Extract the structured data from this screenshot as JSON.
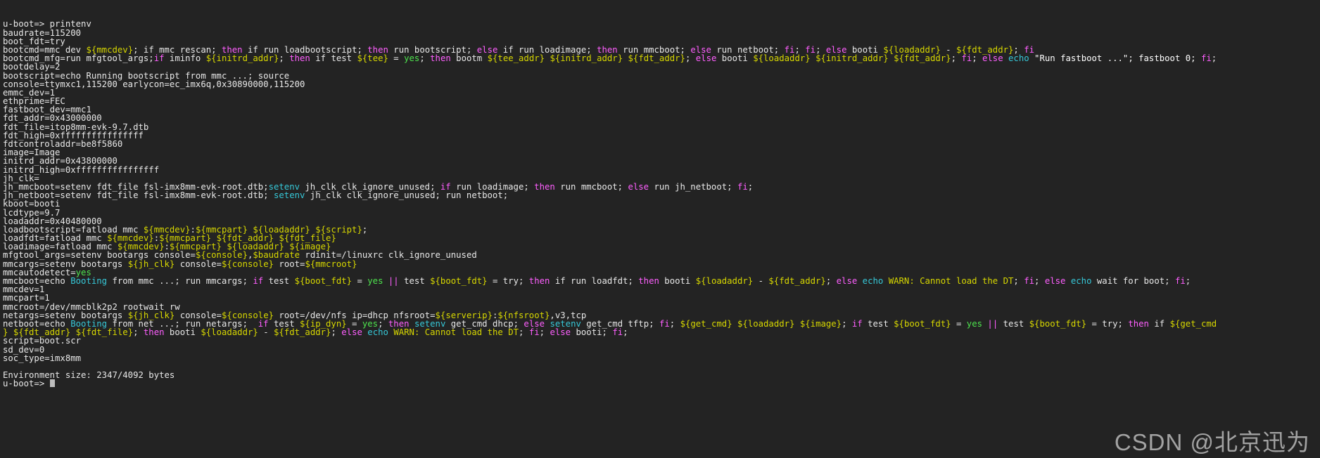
{
  "terminal": {
    "title": "u-boot console",
    "prompt": "u-boot=> ",
    "command": "printenv",
    "env_size_line": "Environment size: 2347/4092 bytes",
    "colors": {
      "background": "#232323",
      "foreground": "#e8e8e8",
      "variable": "#d7d700",
      "keyword": "#ff5fff",
      "command": "#36c8d8",
      "true_value": "#4ee44e",
      "warning": "#d7d700",
      "watermark": "#b9b9b9"
    },
    "lines": [
      [
        {
          "t": "u-boot=> printenv",
          "c": "plain"
        }
      ],
      [
        {
          "t": "baudrate=115200",
          "c": "plain"
        }
      ],
      [
        {
          "t": "boot_fdt=try",
          "c": "plain"
        }
      ],
      [
        {
          "t": "bootcmd=mmc dev ",
          "c": "plain"
        },
        {
          "t": "${mmcdev}",
          "c": "var"
        },
        {
          "t": "; if mmc rescan; ",
          "c": "plain"
        },
        {
          "t": "then",
          "c": "kw"
        },
        {
          "t": " if run loadbootscript; ",
          "c": "plain"
        },
        {
          "t": "then",
          "c": "kw"
        },
        {
          "t": " run bootscript; ",
          "c": "plain"
        },
        {
          "t": "else",
          "c": "kw"
        },
        {
          "t": " if run loadimage; ",
          "c": "plain"
        },
        {
          "t": "then",
          "c": "kw"
        },
        {
          "t": " run mmcboot; ",
          "c": "plain"
        },
        {
          "t": "else",
          "c": "kw"
        },
        {
          "t": " run netboot; ",
          "c": "plain"
        },
        {
          "t": "fi",
          "c": "kw"
        },
        {
          "t": "; ",
          "c": "plain"
        },
        {
          "t": "fi",
          "c": "kw"
        },
        {
          "t": "; ",
          "c": "plain"
        },
        {
          "t": "else",
          "c": "kw"
        },
        {
          "t": " booti ",
          "c": "plain"
        },
        {
          "t": "${loadaddr}",
          "c": "var"
        },
        {
          "t": " - ",
          "c": "plain"
        },
        {
          "t": "${fdt_addr}",
          "c": "var"
        },
        {
          "t": "; ",
          "c": "plain"
        },
        {
          "t": "fi",
          "c": "kw"
        }
      ],
      [
        {
          "t": "bootcmd_mfg=run mfgtool_args;",
          "c": "plain"
        },
        {
          "t": "if",
          "c": "kw"
        },
        {
          "t": " iminfo ",
          "c": "plain"
        },
        {
          "t": "${initrd_addr}",
          "c": "var"
        },
        {
          "t": "; ",
          "c": "plain"
        },
        {
          "t": "then",
          "c": "kw"
        },
        {
          "t": " if test ",
          "c": "plain"
        },
        {
          "t": "${tee}",
          "c": "var"
        },
        {
          "t": " = ",
          "c": "plain"
        },
        {
          "t": "yes",
          "c": "yes"
        },
        {
          "t": "; ",
          "c": "plain"
        },
        {
          "t": "then",
          "c": "kw"
        },
        {
          "t": " bootm ",
          "c": "plain"
        },
        {
          "t": "${tee_addr}",
          "c": "var"
        },
        {
          "t": " ",
          "c": "plain"
        },
        {
          "t": "${initrd_addr}",
          "c": "var"
        },
        {
          "t": " ",
          "c": "plain"
        },
        {
          "t": "${fdt_addr}",
          "c": "var"
        },
        {
          "t": "; ",
          "c": "plain"
        },
        {
          "t": "else",
          "c": "kw"
        },
        {
          "t": " booti ",
          "c": "plain"
        },
        {
          "t": "${loadaddr}",
          "c": "var"
        },
        {
          "t": " ",
          "c": "plain"
        },
        {
          "t": "${initrd_addr}",
          "c": "var"
        },
        {
          "t": " ",
          "c": "plain"
        },
        {
          "t": "${fdt_addr}",
          "c": "var"
        },
        {
          "t": "; ",
          "c": "plain"
        },
        {
          "t": "fi",
          "c": "kw"
        },
        {
          "t": "; ",
          "c": "plain"
        },
        {
          "t": "else",
          "c": "kw"
        },
        {
          "t": " ",
          "c": "plain"
        },
        {
          "t": "echo",
          "c": "cmd"
        },
        {
          "t": " \"Run fastboot ...\"; fastboot 0; ",
          "c": "str"
        },
        {
          "t": "fi",
          "c": "kw"
        },
        {
          "t": ";",
          "c": "plain"
        }
      ],
      [
        {
          "t": "bootdelay=2",
          "c": "plain"
        }
      ],
      [
        {
          "t": "bootscript=echo Running bootscript from mmc ...; source",
          "c": "plain"
        }
      ],
      [
        {
          "t": "console=ttymxc1,115200 earlycon=ec_imx6q,0x30890000,115200",
          "c": "plain"
        }
      ],
      [
        {
          "t": "emmc_dev=1",
          "c": "plain"
        }
      ],
      [
        {
          "t": "ethprime=FEC",
          "c": "plain"
        }
      ],
      [
        {
          "t": "fastboot_dev=mmc1",
          "c": "plain"
        }
      ],
      [
        {
          "t": "fdt_addr=0x43000000",
          "c": "plain"
        }
      ],
      [
        {
          "t": "fdt_file=itop8mm-evk-9.7.dtb",
          "c": "plain"
        }
      ],
      [
        {
          "t": "fdt_high=0xffffffffffffffff",
          "c": "plain"
        }
      ],
      [
        {
          "t": "fdtcontroladdr=be8f5860",
          "c": "plain"
        }
      ],
      [
        {
          "t": "image=Image",
          "c": "plain"
        }
      ],
      [
        {
          "t": "initrd_addr=0x43800000",
          "c": "plain"
        }
      ],
      [
        {
          "t": "initrd_high=0xffffffffffffffff",
          "c": "plain"
        }
      ],
      [
        {
          "t": "jh_clk=",
          "c": "plain"
        }
      ],
      [
        {
          "t": "jh_mmcboot=setenv fdt_file fsl-imx8mm-evk-root.dtb;",
          "c": "plain"
        },
        {
          "t": "setenv",
          "c": "cmd"
        },
        {
          "t": " jh_clk clk_ignore_unused; ",
          "c": "plain"
        },
        {
          "t": "if",
          "c": "kw"
        },
        {
          "t": " run loadimage; ",
          "c": "plain"
        },
        {
          "t": "then",
          "c": "kw"
        },
        {
          "t": " run mmcboot; ",
          "c": "plain"
        },
        {
          "t": "else",
          "c": "kw"
        },
        {
          "t": " run jh_netboot; ",
          "c": "plain"
        },
        {
          "t": "fi",
          "c": "kw"
        },
        {
          "t": ";",
          "c": "plain"
        }
      ],
      [
        {
          "t": "jh_netboot=setenv fdt_file fsl-imx8mm-evk-root.dtb; ",
          "c": "plain"
        },
        {
          "t": "setenv",
          "c": "cmd"
        },
        {
          "t": " jh_clk clk_ignore_unused; run netboot;",
          "c": "plain"
        }
      ],
      [
        {
          "t": "kboot=booti",
          "c": "plain"
        }
      ],
      [
        {
          "t": "lcdtype=9.7",
          "c": "plain"
        }
      ],
      [
        {
          "t": "loadaddr=0x40480000",
          "c": "plain"
        }
      ],
      [
        {
          "t": "loadbootscript=fatload mmc ",
          "c": "plain"
        },
        {
          "t": "${mmcdev}",
          "c": "var"
        },
        {
          "t": ":",
          "c": "plain"
        },
        {
          "t": "${mmcpart}",
          "c": "var"
        },
        {
          "t": " ",
          "c": "plain"
        },
        {
          "t": "${loadaddr}",
          "c": "var"
        },
        {
          "t": " ",
          "c": "plain"
        },
        {
          "t": "${script}",
          "c": "var"
        },
        {
          "t": ";",
          "c": "plain"
        }
      ],
      [
        {
          "t": "loadfdt=fatload mmc ",
          "c": "plain"
        },
        {
          "t": "${mmcdev}",
          "c": "var"
        },
        {
          "t": ":",
          "c": "plain"
        },
        {
          "t": "${mmcpart}",
          "c": "var"
        },
        {
          "t": " ",
          "c": "plain"
        },
        {
          "t": "${fdt_addr}",
          "c": "var"
        },
        {
          "t": " ",
          "c": "plain"
        },
        {
          "t": "${fdt_file}",
          "c": "var"
        }
      ],
      [
        {
          "t": "loadimage=fatload mmc ",
          "c": "plain"
        },
        {
          "t": "${mmcdev}",
          "c": "var"
        },
        {
          "t": ":",
          "c": "plain"
        },
        {
          "t": "${mmcpart}",
          "c": "var"
        },
        {
          "t": " ",
          "c": "plain"
        },
        {
          "t": "${loadaddr}",
          "c": "var"
        },
        {
          "t": " ",
          "c": "plain"
        },
        {
          "t": "${image}",
          "c": "var"
        }
      ],
      [
        {
          "t": "mfgtool_args=setenv bootargs console=",
          "c": "plain"
        },
        {
          "t": "${console}",
          "c": "var"
        },
        {
          "t": ",",
          "c": "plain"
        },
        {
          "t": "$baudrate",
          "c": "var"
        },
        {
          "t": " rdinit=/linuxrc clk_ignore_unused",
          "c": "plain"
        }
      ],
      [
        {
          "t": "mmcargs=setenv bootargs ",
          "c": "plain"
        },
        {
          "t": "${jh_clk}",
          "c": "var"
        },
        {
          "t": " console=",
          "c": "plain"
        },
        {
          "t": "${console}",
          "c": "var"
        },
        {
          "t": " root=",
          "c": "plain"
        },
        {
          "t": "${mmcroot}",
          "c": "var"
        }
      ],
      [
        {
          "t": "mmcautodetect=",
          "c": "plain"
        },
        {
          "t": "yes",
          "c": "yes"
        }
      ],
      [
        {
          "t": "mmcboot=echo ",
          "c": "plain"
        },
        {
          "t": "Booting",
          "c": "boot"
        },
        {
          "t": " from mmc ...; run mmcargs; ",
          "c": "plain"
        },
        {
          "t": "if",
          "c": "kw"
        },
        {
          "t": " test ",
          "c": "plain"
        },
        {
          "t": "${boot_fdt}",
          "c": "var"
        },
        {
          "t": " = ",
          "c": "plain"
        },
        {
          "t": "yes",
          "c": "yes"
        },
        {
          "t": " ",
          "c": "plain"
        },
        {
          "t": "||",
          "c": "or"
        },
        {
          "t": " test ",
          "c": "plain"
        },
        {
          "t": "${boot_fdt}",
          "c": "var"
        },
        {
          "t": " = try; ",
          "c": "plain"
        },
        {
          "t": "then",
          "c": "kw"
        },
        {
          "t": " if run loadfdt; ",
          "c": "plain"
        },
        {
          "t": "then",
          "c": "kw"
        },
        {
          "t": " booti ",
          "c": "plain"
        },
        {
          "t": "${loadaddr}",
          "c": "var"
        },
        {
          "t": " - ",
          "c": "plain"
        },
        {
          "t": "${fdt_addr}",
          "c": "var"
        },
        {
          "t": "; ",
          "c": "plain"
        },
        {
          "t": "else",
          "c": "kw"
        },
        {
          "t": " ",
          "c": "plain"
        },
        {
          "t": "echo",
          "c": "cmd"
        },
        {
          "t": " ",
          "c": "plain"
        },
        {
          "t": "WARN: Cannot load the DT",
          "c": "warn"
        },
        {
          "t": "; ",
          "c": "plain"
        },
        {
          "t": "fi",
          "c": "kw"
        },
        {
          "t": "; ",
          "c": "plain"
        },
        {
          "t": "else",
          "c": "kw"
        },
        {
          "t": " ",
          "c": "plain"
        },
        {
          "t": "echo",
          "c": "cmd"
        },
        {
          "t": " wait for boot; ",
          "c": "plain"
        },
        {
          "t": "fi",
          "c": "kw"
        },
        {
          "t": ";",
          "c": "plain"
        }
      ],
      [
        {
          "t": "mmcdev=1",
          "c": "plain"
        }
      ],
      [
        {
          "t": "mmcpart=1",
          "c": "plain"
        }
      ],
      [
        {
          "t": "mmcroot=/dev/mmcblk2p2 rootwait rw",
          "c": "plain"
        }
      ],
      [
        {
          "t": "netargs=setenv bootargs ",
          "c": "plain"
        },
        {
          "t": "${jh_clk}",
          "c": "var"
        },
        {
          "t": " console=",
          "c": "plain"
        },
        {
          "t": "${console}",
          "c": "var"
        },
        {
          "t": " root=/dev/nfs ip=dhcp nfsroot=",
          "c": "plain"
        },
        {
          "t": "${serverip}",
          "c": "var"
        },
        {
          "t": ":",
          "c": "plain"
        },
        {
          "t": "${nfsroot}",
          "c": "var"
        },
        {
          "t": ",v3,tcp",
          "c": "plain"
        }
      ],
      [
        {
          "t": "netboot=echo ",
          "c": "plain"
        },
        {
          "t": "Booting",
          "c": "boot"
        },
        {
          "t": " from net ...; run netargs;  ",
          "c": "plain"
        },
        {
          "t": "if",
          "c": "kw"
        },
        {
          "t": " test ",
          "c": "plain"
        },
        {
          "t": "${ip_dyn}",
          "c": "var"
        },
        {
          "t": " = ",
          "c": "plain"
        },
        {
          "t": "yes",
          "c": "yes"
        },
        {
          "t": "; ",
          "c": "plain"
        },
        {
          "t": "then",
          "c": "kw"
        },
        {
          "t": " ",
          "c": "plain"
        },
        {
          "t": "setenv",
          "c": "cmd"
        },
        {
          "t": " get_cmd dhcp; ",
          "c": "plain"
        },
        {
          "t": "else",
          "c": "kw"
        },
        {
          "t": " ",
          "c": "plain"
        },
        {
          "t": "setenv",
          "c": "cmd"
        },
        {
          "t": " get_cmd tftp; ",
          "c": "plain"
        },
        {
          "t": "fi",
          "c": "kw"
        },
        {
          "t": "; ",
          "c": "plain"
        },
        {
          "t": "${get_cmd}",
          "c": "var"
        },
        {
          "t": " ",
          "c": "plain"
        },
        {
          "t": "${loadaddr}",
          "c": "var"
        },
        {
          "t": " ",
          "c": "plain"
        },
        {
          "t": "${image}",
          "c": "var"
        },
        {
          "t": "; ",
          "c": "plain"
        },
        {
          "t": "if",
          "c": "kw"
        },
        {
          "t": " test ",
          "c": "plain"
        },
        {
          "t": "${boot_fdt}",
          "c": "var"
        },
        {
          "t": " = ",
          "c": "plain"
        },
        {
          "t": "yes",
          "c": "yes"
        },
        {
          "t": " ",
          "c": "plain"
        },
        {
          "t": "||",
          "c": "or"
        },
        {
          "t": " test ",
          "c": "plain"
        },
        {
          "t": "${boot_fdt}",
          "c": "var"
        },
        {
          "t": " = try; ",
          "c": "plain"
        },
        {
          "t": "then",
          "c": "kw"
        },
        {
          "t": " if ",
          "c": "plain"
        },
        {
          "t": "${get_cmd",
          "c": "var"
        }
      ],
      [
        {
          "t": "} ",
          "c": "var"
        },
        {
          "t": "${fdt_addr}",
          "c": "var"
        },
        {
          "t": " ",
          "c": "plain"
        },
        {
          "t": "${fdt_file}",
          "c": "var"
        },
        {
          "t": "; ",
          "c": "plain"
        },
        {
          "t": "then",
          "c": "kw"
        },
        {
          "t": " booti ",
          "c": "plain"
        },
        {
          "t": "${loadaddr}",
          "c": "var"
        },
        {
          "t": " - ",
          "c": "plain"
        },
        {
          "t": "${fdt_addr}",
          "c": "var"
        },
        {
          "t": "; ",
          "c": "plain"
        },
        {
          "t": "else",
          "c": "kw"
        },
        {
          "t": " ",
          "c": "plain"
        },
        {
          "t": "echo",
          "c": "cmd"
        },
        {
          "t": " ",
          "c": "plain"
        },
        {
          "t": "WARN: Cannot load the DT",
          "c": "warn"
        },
        {
          "t": "; ",
          "c": "plain"
        },
        {
          "t": "fi",
          "c": "kw"
        },
        {
          "t": "; ",
          "c": "plain"
        },
        {
          "t": "else",
          "c": "kw"
        },
        {
          "t": " booti; ",
          "c": "plain"
        },
        {
          "t": "fi",
          "c": "kw"
        },
        {
          "t": ";",
          "c": "plain"
        }
      ],
      [
        {
          "t": "script=boot.scr",
          "c": "plain"
        }
      ],
      [
        {
          "t": "sd_dev=0",
          "c": "plain"
        }
      ],
      [
        {
          "t": "soc_type=imx8mm",
          "c": "plain"
        }
      ],
      [
        {
          "t": "",
          "c": "plain"
        }
      ],
      [
        {
          "t": "Environment size: 2347/4092 bytes",
          "c": "plain"
        }
      ],
      [
        {
          "t": "u-boot=> ",
          "c": "plain"
        },
        {
          "t": "",
          "c": "cursor"
        }
      ]
    ]
  },
  "watermark": {
    "text": "CSDN @北京迅为"
  }
}
